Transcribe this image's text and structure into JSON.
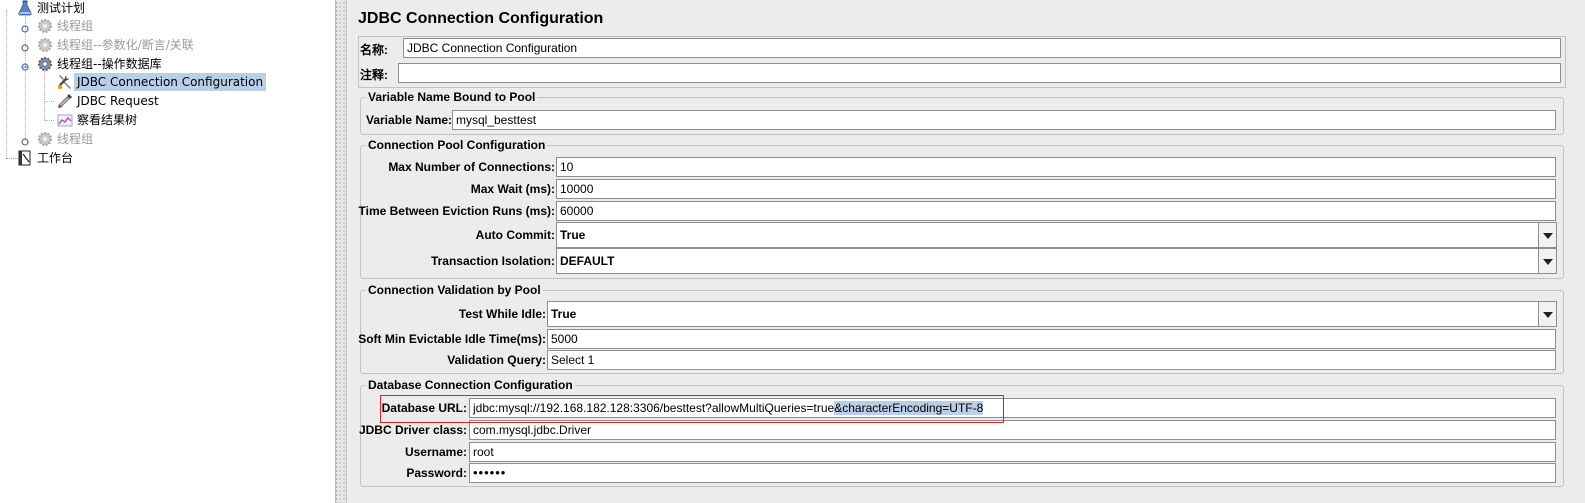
{
  "tree": {
    "items": [
      {
        "label": "测试计划",
        "icon": "test-plan-icon",
        "disabled": false,
        "selected": false
      },
      {
        "label": "线程组",
        "icon": "gear-icon",
        "disabled": true,
        "selected": false
      },
      {
        "label": "线程组--参数化/断言/关联",
        "icon": "gear-icon",
        "disabled": true,
        "selected": false
      },
      {
        "label": "线程组--操作数据库",
        "icon": "gear-icon",
        "disabled": false,
        "selected": false
      },
      {
        "label": "JDBC Connection Configuration",
        "icon": "wrench-icon",
        "disabled": false,
        "selected": true
      },
      {
        "label": "JDBC Request",
        "icon": "pipette-icon",
        "disabled": false,
        "selected": false
      },
      {
        "label": "察看结果树",
        "icon": "result-tree-icon",
        "disabled": false,
        "selected": false
      },
      {
        "label": "线程组",
        "icon": "gear-icon",
        "disabled": true,
        "selected": false
      },
      {
        "label": "工作台",
        "icon": "workbench-icon",
        "disabled": false,
        "selected": false
      }
    ]
  },
  "panel": {
    "title": "JDBC Connection Configuration",
    "name_label": "名称:",
    "name_value": "JDBC Connection Configuration",
    "comment_label": "注释:",
    "comment_value": ""
  },
  "variable_group": {
    "title": "Variable Name Bound to Pool",
    "variable_name_label": "Variable Name:",
    "variable_name_value": "mysql_besttest"
  },
  "pool_group": {
    "title": "Connection Pool Configuration",
    "max_connections_label": "Max Number of Connections:",
    "max_connections_value": "10",
    "max_wait_label": "Max Wait (ms):",
    "max_wait_value": "10000",
    "eviction_label": "Time Between Eviction Runs (ms):",
    "eviction_value": "60000",
    "auto_commit_label": "Auto Commit:",
    "auto_commit_value": "True",
    "isolation_label": "Transaction Isolation:",
    "isolation_value": "DEFAULT"
  },
  "validation_group": {
    "title": "Connection Validation by Pool",
    "test_idle_label": "Test While Idle:",
    "test_idle_value": "True",
    "soft_min_label": "Soft Min Evictable Idle Time(ms):",
    "soft_min_value": "5000",
    "validation_query_label": "Validation Query:",
    "validation_query_value": "Select 1"
  },
  "db_group": {
    "title": "Database Connection Configuration",
    "url_label": "Database URL:",
    "url_value_plain": "jdbc:mysql://192.168.182.128:3306/besttest?allowMultiQueries=true",
    "url_value_selected": "&characterEncoding=UTF-8",
    "driver_label": "JDBC Driver class:",
    "driver_value": "com.mysql.jdbc.Driver",
    "username_label": "Username:",
    "username_value": "root",
    "password_label": "Password:",
    "password_value": "••••••"
  },
  "colors": {
    "selection": "#b9cfe8",
    "highlight_box": "#e02020",
    "disabled_text": "#9a9a9a"
  }
}
